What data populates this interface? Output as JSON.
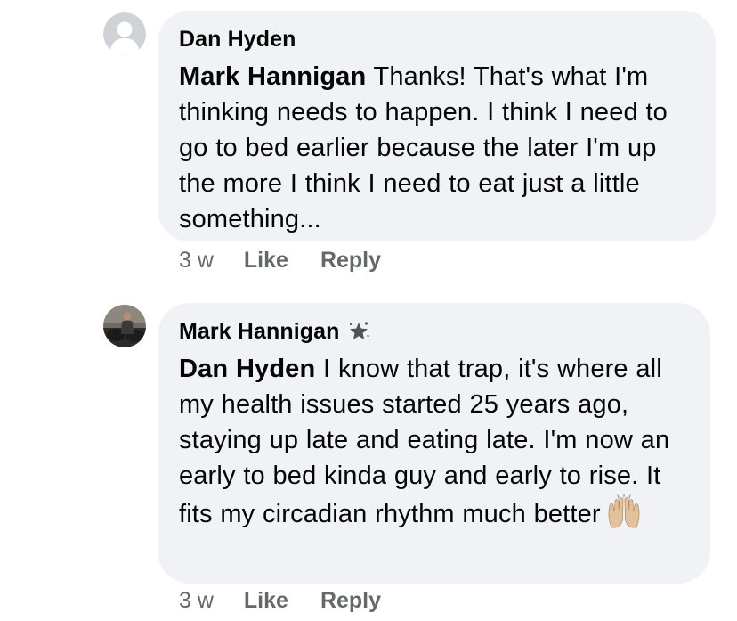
{
  "comments": [
    {
      "author": "Dan Hyden",
      "avatar": "default-user-silhouette",
      "mention": "Mark Hannigan",
      "text": " Thanks! That's what I'm thinking needs to happen. I think I need to go to bed earlier because the later I'm up the more I think I need to eat just a little something...",
      "timestamp": "3 w",
      "like_label": "Like",
      "reply_label": "Reply"
    },
    {
      "author": "Mark Hannigan",
      "avatar": "user-photo",
      "badge_icon": "top-fan-star-icon",
      "mention": "Dan Hyden",
      "text": " I know that trap, it's where all my health issues started 25 years ago, staying up late and eating late. I'm now an early to bed kinda guy and early to rise. It fits my circadian rhythm much better",
      "emoji": "raising-hands-emoji",
      "timestamp": "3 w",
      "like_label": "Like",
      "reply_label": "Reply"
    }
  ],
  "colors": {
    "bubble_bg": "#f0f2f5",
    "text": "#050505",
    "meta": "#65676b"
  }
}
